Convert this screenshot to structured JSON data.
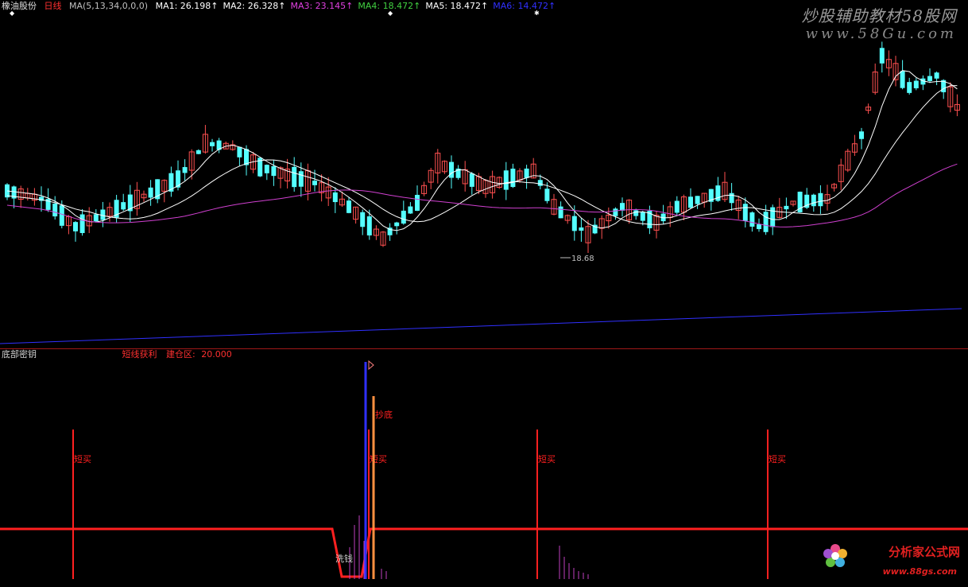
{
  "header": {
    "stock_name": "橡油股份",
    "period": "日线",
    "ma_params": "MA(5,13,34,0,0,0)",
    "ma_lines": [
      {
        "label": "MA1:",
        "value": "26.198",
        "color": "#ffffff"
      },
      {
        "label": "MA2:",
        "value": "26.328",
        "color": "#ffffff"
      },
      {
        "label": "MA3:",
        "value": "23.145",
        "color": "#e040e0"
      },
      {
        "label": "MA4:",
        "value": "18.472",
        "color": "#40d040"
      },
      {
        "label": "MA5:",
        "value": "18.472",
        "color": "#ffffff"
      },
      {
        "label": "MA6:",
        "value": "14.472",
        "color": "#3030ff"
      }
    ],
    "arrow": "↑"
  },
  "watermark": {
    "title": "炒股辅助教材58股网",
    "url": "www.58Gu.com"
  },
  "main_chart": {
    "low_label": "18.68",
    "colors": {
      "up": "#ff5050",
      "down": "#54ffff",
      "ma_short": "#ffffff",
      "ma_mid": "#ffffff",
      "ma_long": "#d040d0",
      "ma_blue": "#3030ff"
    }
  },
  "sub_panel": {
    "title": "底部密钥",
    "indicator_name": "短线获利",
    "zone_label": "建仓区:",
    "zone_value": "20.000",
    "signals": {
      "buy": "短买",
      "bottom": "抄底",
      "wash": "洗钱"
    },
    "colors": {
      "line": "#ff2020",
      "blue": "#3030ff",
      "orange": "#ff9040",
      "purple": "#c040c0"
    }
  },
  "brand": {
    "name": "分析家公式网",
    "url": "www.88gs.com"
  }
}
